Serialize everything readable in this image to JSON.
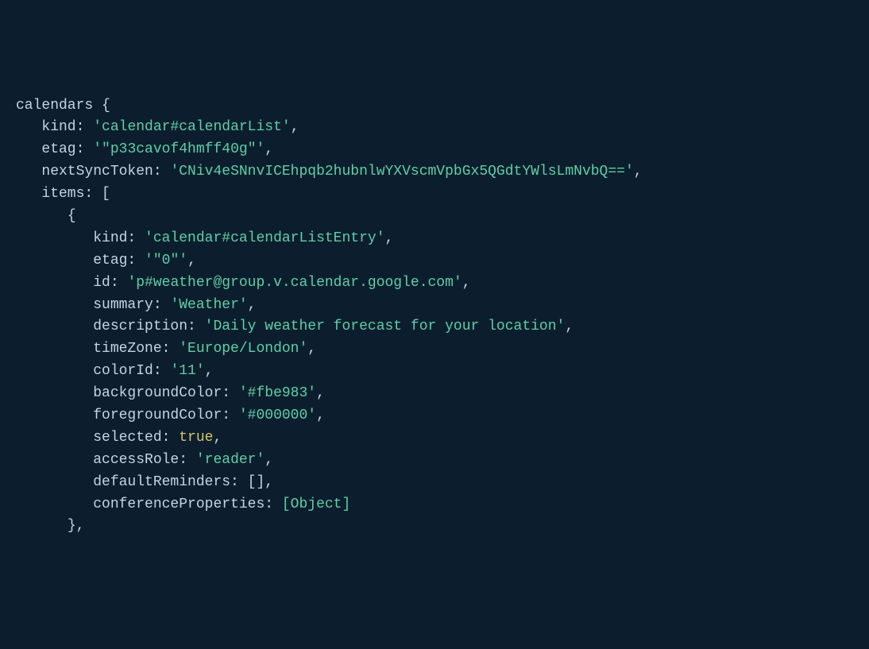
{
  "indent": {
    "i0": "",
    "i1": "   ",
    "i2": "      ",
    "i3": "         "
  },
  "root": {
    "name": "calendars",
    "open": " {",
    "kind_key": "kind:",
    "kind_val": "'calendar#calendarList'",
    "comma": ",",
    "etag_key": "etag:",
    "etag_val": "'\"p33cavof4hmff40g\"'",
    "nst_key": "nextSyncToken:",
    "nst_val": "'CNiv4eSNnvICEhpqb2hubnlwYXVscmVpbGx5QGdtYWlsLmNvbQ=='",
    "items_key": "items:",
    "items_open": " [",
    "obj_open": "{",
    "obj_close": "},"
  },
  "item": {
    "kind_key": "kind:",
    "kind_val": "'calendar#calendarListEntry'",
    "etag_key": "etag:",
    "etag_val": "'\"0\"'",
    "id_key": "id:",
    "id_val": "'p#weather@group.v.calendar.google.com'",
    "summary_key": "summary:",
    "summary_val": "'Weather'",
    "desc_key": "description:",
    "desc_val": "'Daily weather forecast for your location'",
    "tz_key": "timeZone:",
    "tz_val": "'Europe/London'",
    "colorid_key": "colorId:",
    "colorid_val": "'11'",
    "bg_key": "backgroundColor:",
    "bg_val": "'#fbe983'",
    "fg_key": "foregroundColor:",
    "fg_val": "'#000000'",
    "selected_key": "selected:",
    "selected_val": "true",
    "access_key": "accessRole:",
    "access_val": "'reader'",
    "defrem_key": "defaultReminders:",
    "defrem_val": "[]",
    "confprop_key": "conferenceProperties:",
    "confprop_val": "[Object]"
  }
}
